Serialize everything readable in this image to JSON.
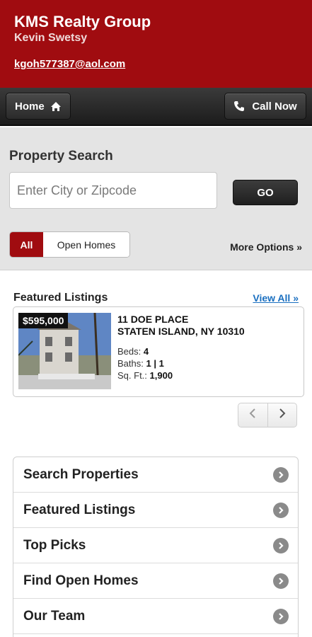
{
  "header": {
    "company": "KMS Realty Group",
    "agent": "Kevin Swetsy",
    "email": "kgoh577387@aol.com"
  },
  "nav": {
    "home_label": "Home",
    "home_icon": "home-icon",
    "call_label": "Call Now",
    "call_icon": "phone-icon"
  },
  "search": {
    "title": "Property Search",
    "placeholder": "Enter City or Zipcode",
    "go_label": "GO",
    "filters": [
      "All",
      "Open Homes"
    ],
    "selected_filter": "All",
    "more_options": "More Options »"
  },
  "featured": {
    "title": "Featured Listings",
    "view_all": "View All »",
    "listing": {
      "price": "$595,000",
      "address_line1": "11 DOE PLACE",
      "address_line2": "STATEN ISLAND, NY 10310",
      "beds_label": "Beds:",
      "beds": "4",
      "baths_label": "Baths:",
      "baths": "1 | 1",
      "sqft_label": "Sq. Ft.:",
      "sqft": "1,900"
    }
  },
  "menu": {
    "items": [
      {
        "label": "Search Properties"
      },
      {
        "label": "Featured Listings"
      },
      {
        "label": "Top Picks"
      },
      {
        "label": "Find Open Homes"
      },
      {
        "label": "Our Team"
      }
    ]
  },
  "colors": {
    "brand_red": "#a00c10",
    "link_blue": "#1a6fc0"
  }
}
